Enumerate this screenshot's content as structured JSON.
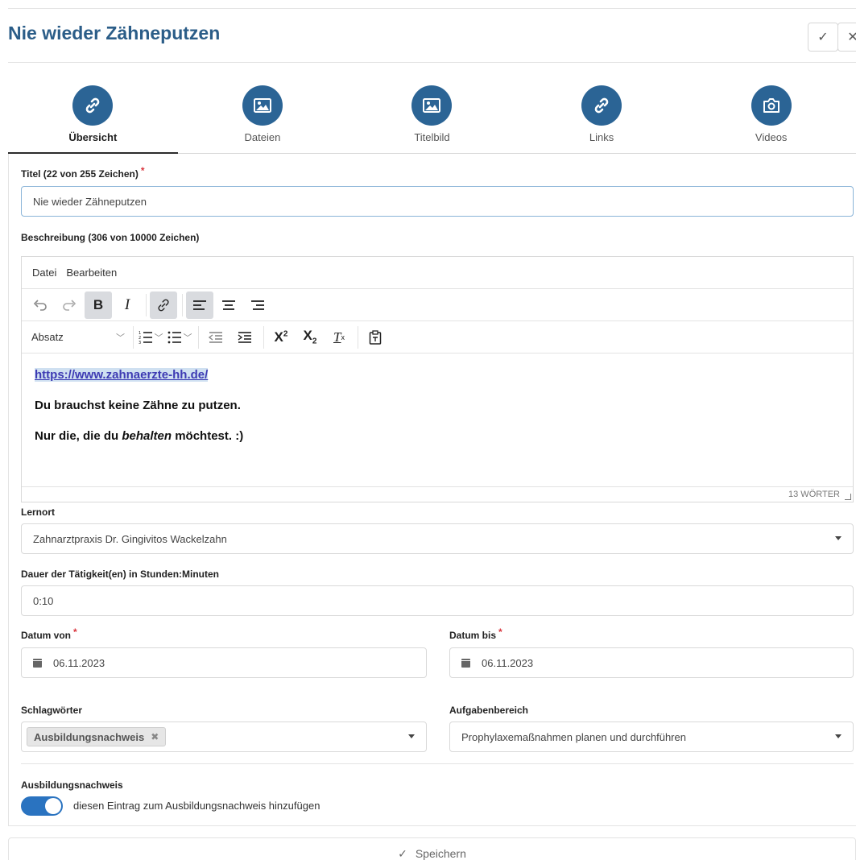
{
  "header": {
    "title": "Nie wieder Zähneputzen",
    "confirm_glyph": "✓",
    "close_glyph": "✕"
  },
  "tabs": [
    {
      "label": "Übersicht",
      "icon": "link-icon"
    },
    {
      "label": "Dateien",
      "icon": "image-icon"
    },
    {
      "label": "Titelbild",
      "icon": "image-icon"
    },
    {
      "label": "Links",
      "icon": "link-icon"
    },
    {
      "label": "Videos",
      "icon": "camera-icon"
    }
  ],
  "form": {
    "title_label": "Titel (22 von 255 Zeichen)",
    "title_value": "Nie wieder Zähneputzen",
    "description_label": "Beschreibung (306 von 10000 Zeichen)",
    "editor": {
      "menu": [
        "Datei",
        "Bearbeiten"
      ],
      "block_format": "Absatz",
      "link_text": "https://www.zahnaerzte-hh.de/",
      "paragraph1": "Du brauchst keine Zähne zu putzen.",
      "paragraph2_pre": "Nur die, die du ",
      "paragraph2_em": "behalten",
      "paragraph2_post": " möchtest. :)",
      "word_count": "13 WÖRTER"
    },
    "location_label": "Lernort",
    "location_value": "Zahnarztpraxis Dr. Gingivitos Wackelzahn",
    "duration_label": "Dauer der Tätigkeit(en) in Stunden:Minuten",
    "duration_value": "0:10",
    "date_from_label": "Datum von",
    "date_from_value": "06.11.2023",
    "date_to_label": "Datum bis",
    "date_to_value": "06.11.2023",
    "keywords_label": "Schlagwörter",
    "keyword_tag": "Ausbildungsnachweis",
    "area_label": "Aufgabenbereich",
    "area_value": "Prophylaxemaßnahmen planen und durchführen",
    "record_label": "Ausbildungsnachweis",
    "record_toggle_on": true,
    "record_toggle_text": "diesen Eintrag zum Ausbildungsnachweis hinzufügen",
    "required_mark": "*"
  },
  "footer": {
    "save_label": "Speichern"
  },
  "colors": {
    "title": "#2b5d88",
    "tab_icon_bg": "#2b6495",
    "toggle_on": "#2a73c0",
    "required": "#d9363e"
  }
}
